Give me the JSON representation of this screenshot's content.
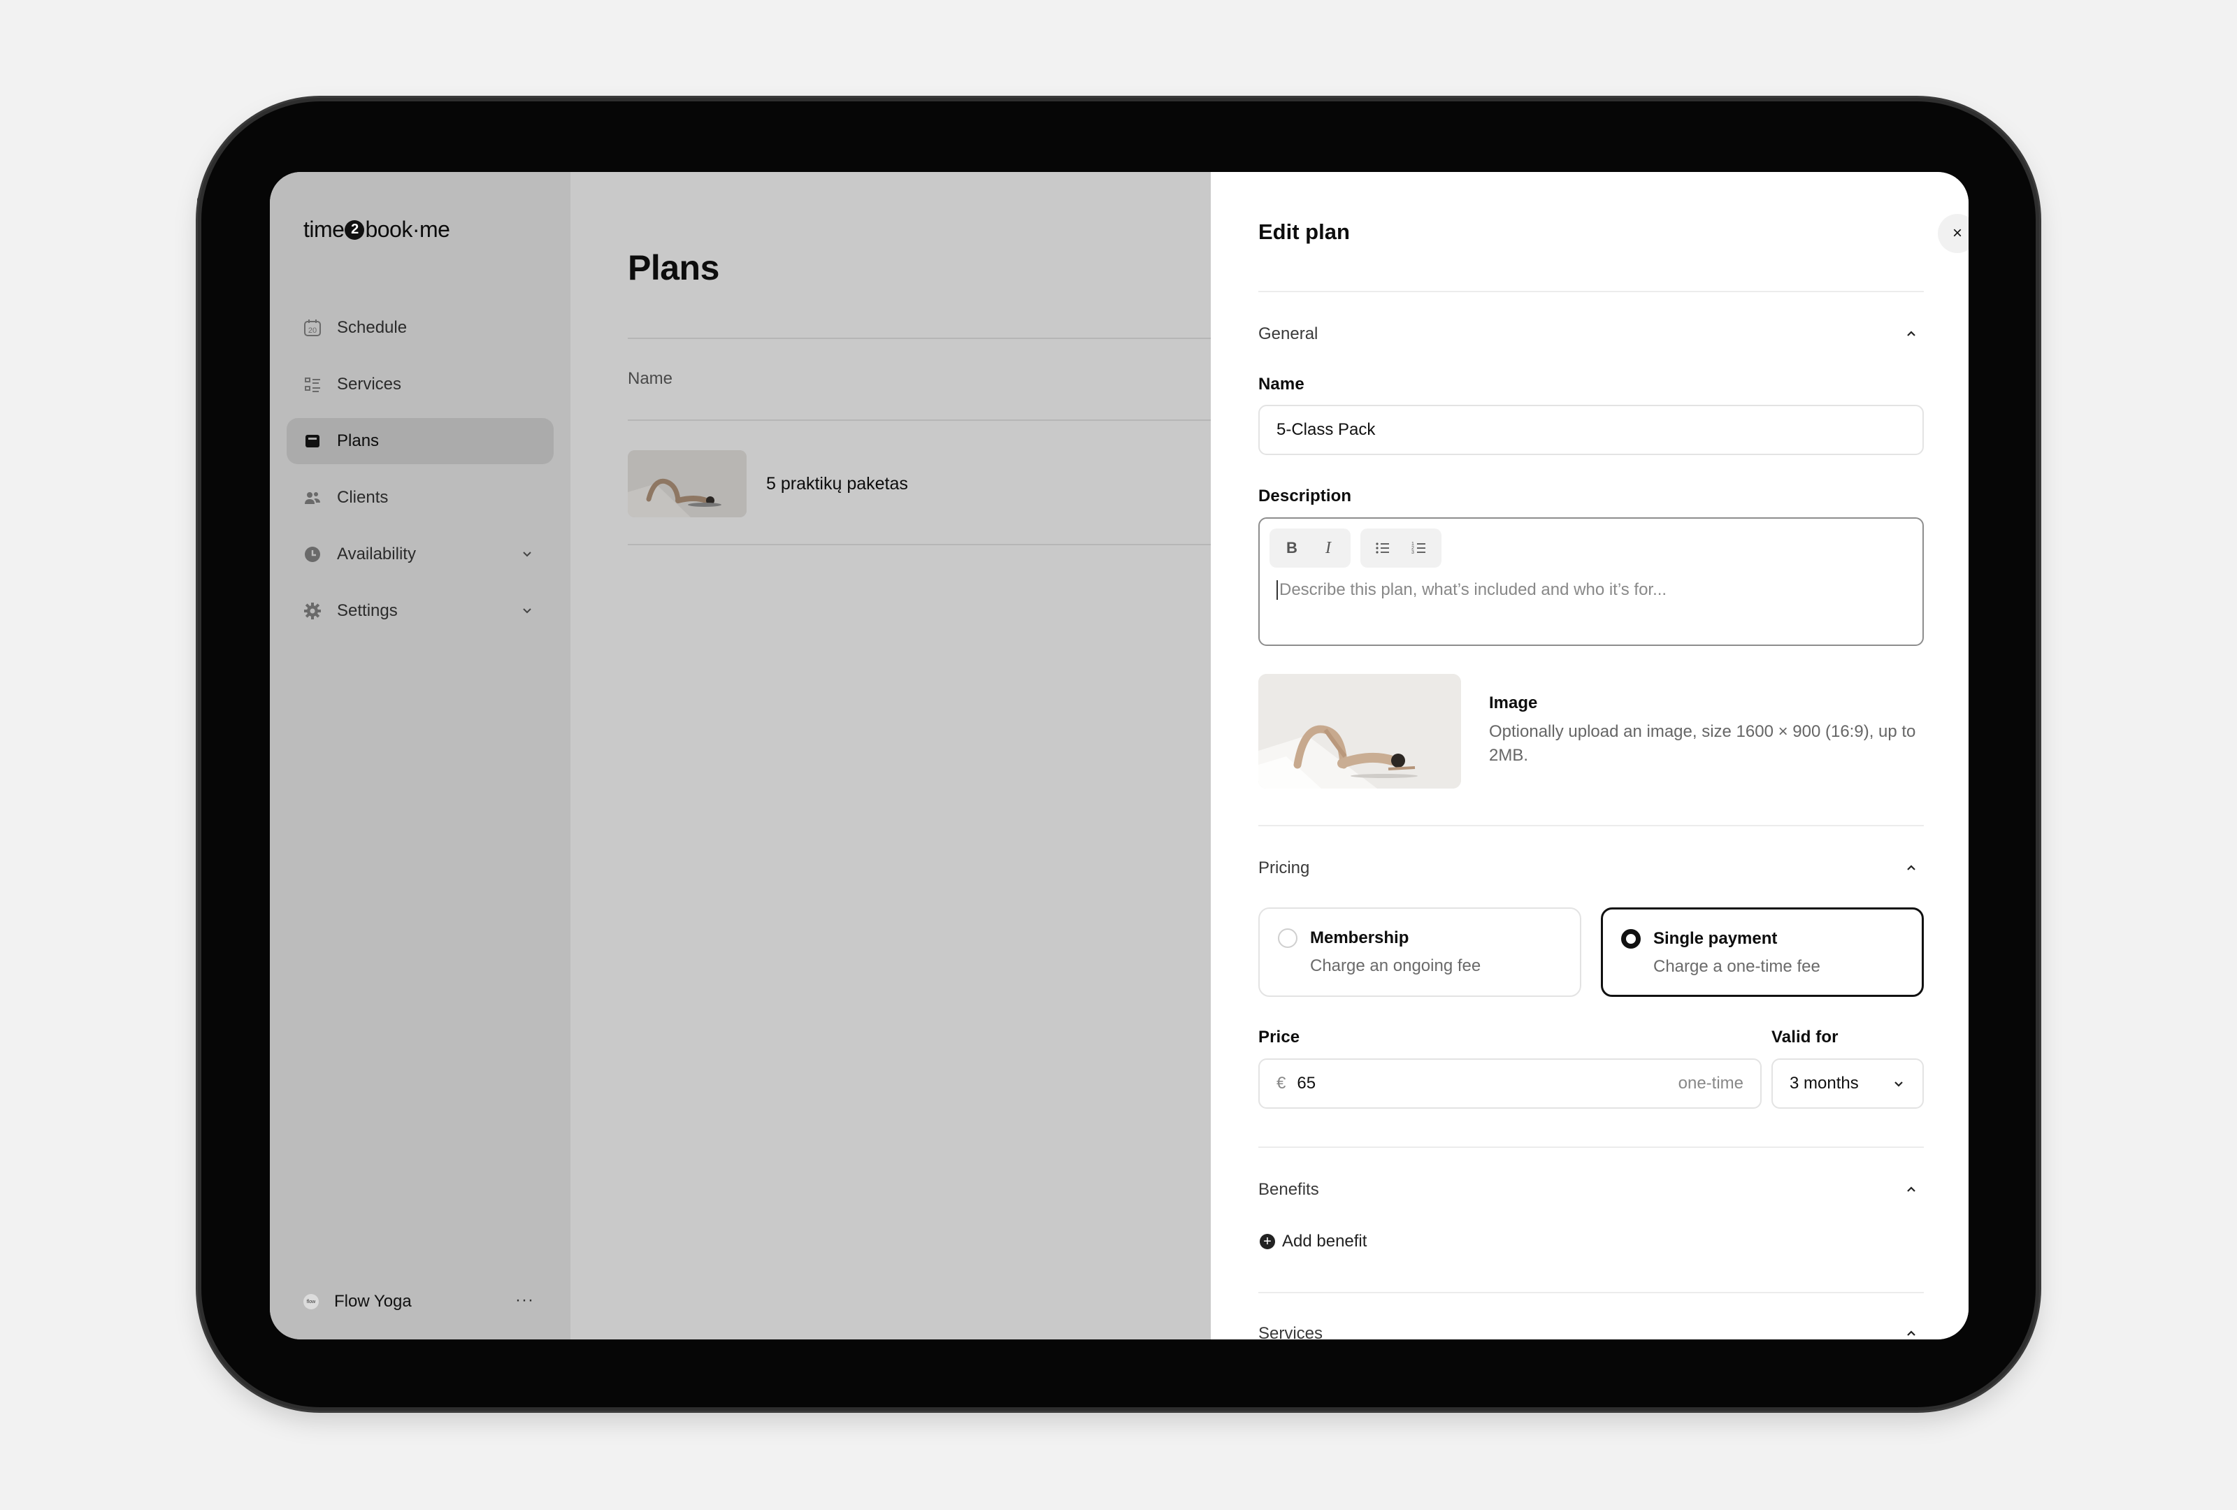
{
  "app": {
    "logo": {
      "part1": "time",
      "part2": "2",
      "part3": "book·me"
    }
  },
  "sidebar": {
    "items": [
      {
        "label": "Schedule",
        "icon": "calendar-icon"
      },
      {
        "label": "Services",
        "icon": "list-icon"
      },
      {
        "label": "Plans",
        "icon": "wallet-icon",
        "active": true
      },
      {
        "label": "Clients",
        "icon": "users-icon"
      },
      {
        "label": "Availability",
        "icon": "clock-icon",
        "expandable": true
      },
      {
        "label": "Settings",
        "icon": "gear-icon",
        "expandable": true
      }
    ],
    "calendar_day": "20",
    "org": {
      "name": "Flow Yoga",
      "avatar_text": "flow",
      "more": "···"
    }
  },
  "main": {
    "title": "Plans",
    "columns": [
      "Name"
    ],
    "rows": [
      {
        "name": "5 praktikų paketas"
      }
    ]
  },
  "drawer": {
    "title": "Edit plan",
    "close": "×",
    "general": {
      "heading": "General",
      "name_label": "Name",
      "name_value": "5-Class Pack",
      "description_label": "Description",
      "toolbar": {
        "bold": "B",
        "italic": "I"
      },
      "description_placeholder": "Describe this plan, what’s included and who it’s for...",
      "image_title": "Image",
      "image_help": "Optionally upload an image, size 1600 × 900 (16:9), up to 2MB."
    },
    "pricing": {
      "heading": "Pricing",
      "options": [
        {
          "title": "Membership",
          "subtitle": "Charge an ongoing fee",
          "selected": false
        },
        {
          "title": "Single payment",
          "subtitle": "Charge a one-time fee",
          "selected": true
        }
      ],
      "price_label": "Price",
      "currency": "€",
      "price_value": "65",
      "price_suffix": "one-time",
      "valid_label": "Valid for",
      "valid_value": "3 months"
    },
    "benefits": {
      "heading": "Benefits",
      "add_label": "Add benefit"
    },
    "services": {
      "heading": "Services"
    }
  },
  "colors": {
    "overlay": "#c9c9c9",
    "sidebar": "#bcbcbc",
    "active_item": "#ababab",
    "accent": "#111111",
    "border": "#e3e3e3"
  }
}
